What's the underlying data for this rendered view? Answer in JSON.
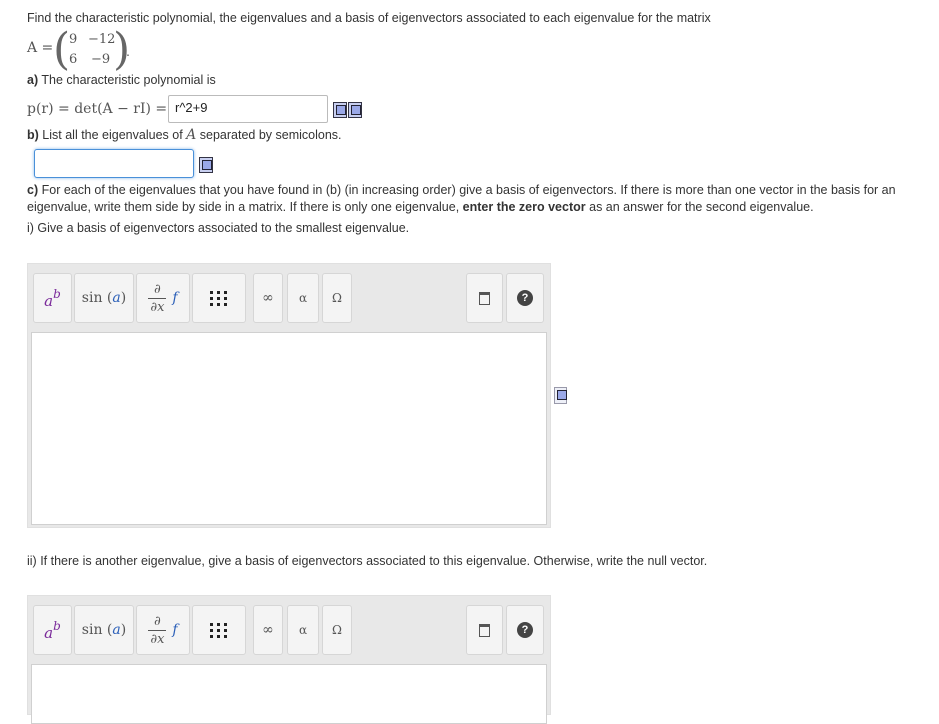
{
  "intro": "Find the characteristic polynomial, the eigenvalues and a basis of eigenvectors associated to each eigenvalue for the matrix",
  "matrix": {
    "lhs": "A =",
    "a11": "9",
    "a12": "−12",
    "a21": "6",
    "a22": "−9",
    "end": "."
  },
  "part_a": {
    "label": "a)",
    "text": "The characteristic polynomial is",
    "lhs": "p(r) = det(A − rI) =",
    "value": "r^2+9"
  },
  "part_b": {
    "label": "b)",
    "text_before": "List all the eigenvalues of",
    "var": "A",
    "text_after": "separated by semicolons.",
    "value": ""
  },
  "part_c": {
    "label": "c)",
    "text1": "For each of the eigenvalues that you have found in (b) (in increasing order) give a basis of eigenvectors. If there is more than one vector in the basis for an",
    "text2": "eigenvalue, write them side by side in a matrix. If there is only one eigenvalue,",
    "bold": "enter the zero vector",
    "text3": "as an answer for the second eigenvalue.",
    "q1": "i) Give a basis of eigenvectors associated to the smallest eigenvalue.",
    "q2": "ii) If there is another eigenvalue, give a basis of eigenvectors associated to this eigenvalue. Otherwise, write the null vector."
  },
  "toolbar": {
    "power": {
      "base": "a",
      "exp": "b"
    },
    "func": {
      "name": "sin",
      "arg": "a"
    },
    "deriv": {
      "num": "∂",
      "den": "∂x",
      "f": "f"
    },
    "infinity": "∞",
    "alpha": "α",
    "omega": "Ω",
    "help": "?"
  },
  "colors": {
    "accent_blue": "#4a90d9",
    "matrix_purple": "#7a2a9a",
    "var_blue": "#2b5fb8"
  }
}
